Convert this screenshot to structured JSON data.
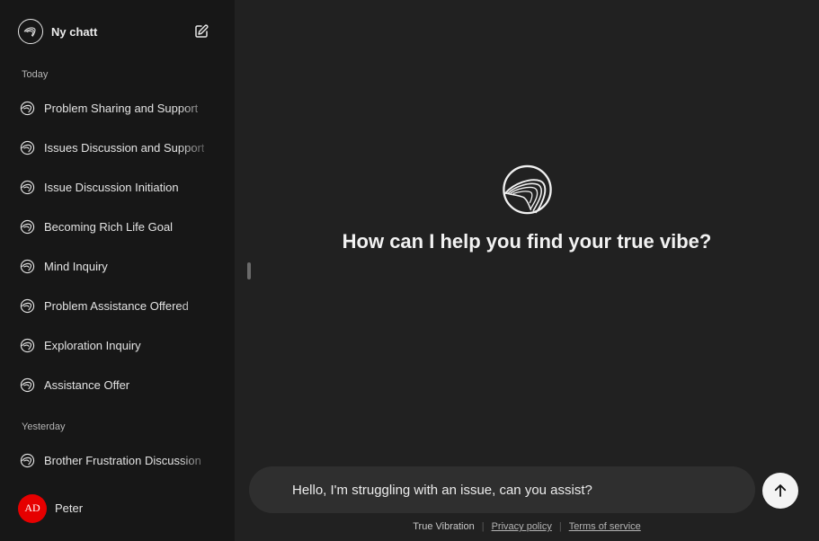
{
  "sidebar": {
    "new_chat_label": "Ny chatt",
    "sections": [
      {
        "label": "Today",
        "items": [
          {
            "label": "Problem Sharing and Support"
          },
          {
            "label": "Issues Discussion and Support"
          },
          {
            "label": "Issue Discussion Initiation"
          },
          {
            "label": "Becoming Rich Life Goal"
          },
          {
            "label": "Mind Inquiry"
          },
          {
            "label": "Problem Assistance Offered"
          },
          {
            "label": "Exploration Inquiry"
          },
          {
            "label": "Assistance Offer"
          }
        ]
      },
      {
        "label": "Yesterday",
        "items": [
          {
            "label": "Brother Frustration Discussion"
          }
        ]
      }
    ],
    "user": {
      "avatar_initials": "AD",
      "name": "Peter"
    }
  },
  "main": {
    "heading": "How can I help you find your true vibe?",
    "composer": {
      "value": "Hello, I'm struggling with an issue, can you assist?"
    },
    "footer": {
      "brand": "True Vibration",
      "privacy_link": "Privacy policy",
      "terms_link": "Terms of service"
    }
  },
  "colors": {
    "sidebar_bg": "#171717",
    "main_bg": "#212121",
    "composer_bg": "#2f2f2f",
    "avatar_bg": "#e60000",
    "send_button_bg": "#f4f4f4"
  },
  "icons": {
    "brand": "swirl-logo-icon",
    "new_chat": "edit-icon",
    "send": "arrow-up-icon"
  }
}
